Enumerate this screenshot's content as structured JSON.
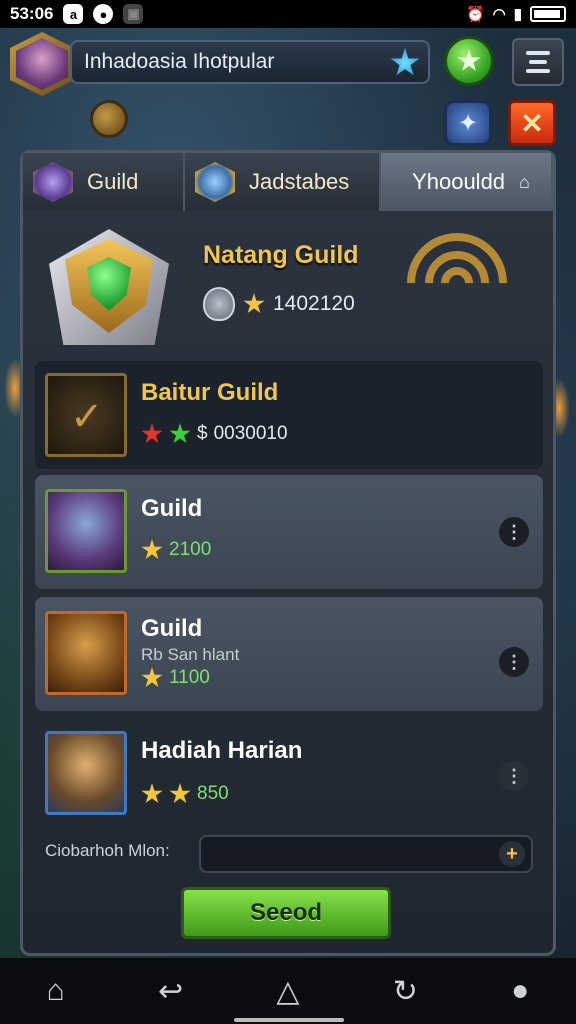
{
  "statusbar": {
    "time": "53:06",
    "icons": [
      "notification-icon",
      "circle-icon",
      "image-icon"
    ],
    "right_icons": [
      "alarm-icon",
      "wifi-icon",
      "signal-icon",
      "battery-icon"
    ]
  },
  "header": {
    "player_name": "Inhadoasia Ihotpular"
  },
  "tabs": [
    {
      "label": "Guild"
    },
    {
      "label": "Jadstabes"
    },
    {
      "label": "Yhoouldd"
    }
  ],
  "guild": {
    "name": "Natang Guild",
    "score": "1402120"
  },
  "rows": [
    {
      "title": "Baitur Guild",
      "value": "0030010",
      "prefix": "$"
    },
    {
      "title": "Guild",
      "value": "2100"
    },
    {
      "title": "Guild",
      "note": "Rb San hlant",
      "value": "1100"
    },
    {
      "title": "Hadiah Harian",
      "value": "850"
    }
  ],
  "search": {
    "label": "Ciobarhoh Mlon:",
    "placeholder": ""
  },
  "send_button": {
    "label": "Seeod"
  },
  "colors": {
    "accent_gold": "#f2c64a",
    "accent_green": "#3d9a1a",
    "close_red": "#c92a0c"
  }
}
